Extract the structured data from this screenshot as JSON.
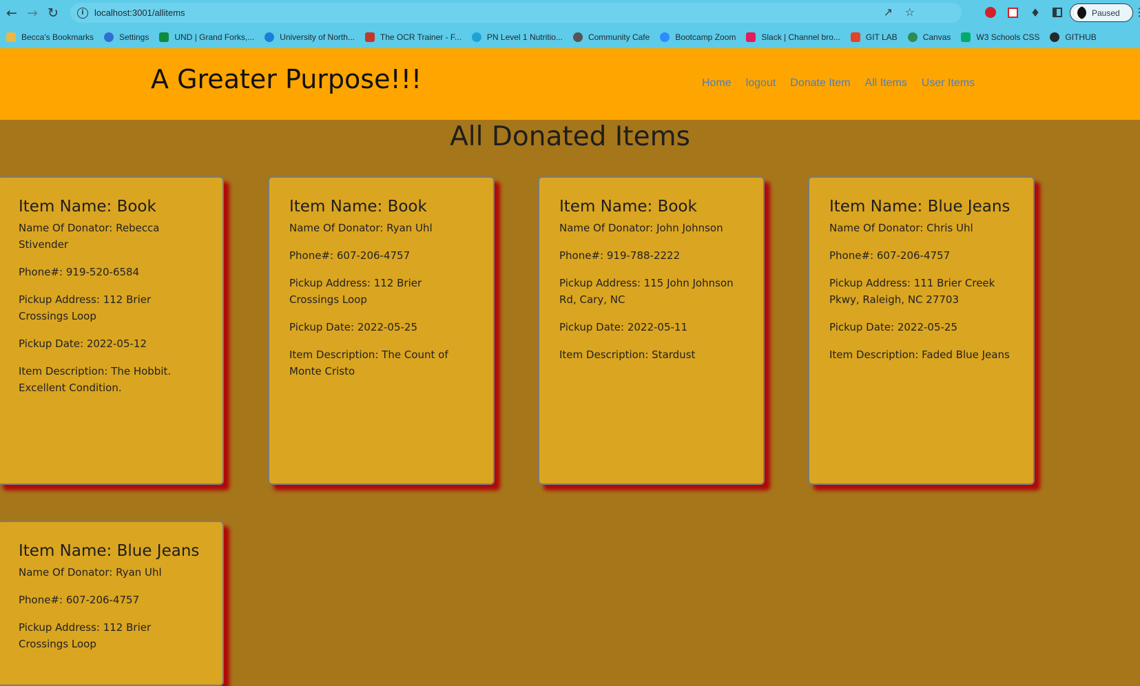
{
  "browser": {
    "url": "localhost:3001/allitems",
    "profile_status": "Paused",
    "bookmarks": [
      {
        "label": "Becca's Bookmarks",
        "icon": "folder-icon",
        "color": "#e8b84a"
      },
      {
        "label": "Settings",
        "icon": "gear-icon",
        "color": "#2f6fd1"
      },
      {
        "label": "UND | Grand Forks,...",
        "icon": "und-logo-icon",
        "color": "#0f8a3c"
      },
      {
        "label": "University of North...",
        "icon": "cloud-icon",
        "color": "#1a7fd6"
      },
      {
        "label": "The OCR Trainer - F...",
        "icon": "ocr-icon",
        "color": "#c0392b"
      },
      {
        "label": "PN Level 1 Nutritio...",
        "icon": "pn-icon",
        "color": "#1fa3d6"
      },
      {
        "label": "Community Cafe",
        "icon": "chrome-icon",
        "color": "#555555"
      },
      {
        "label": "Bootcamp Zoom",
        "icon": "zoom-icon",
        "color": "#2d8cff"
      },
      {
        "label": "Slack | Channel bro...",
        "icon": "slack-icon",
        "color": "#e01e5a"
      },
      {
        "label": "GIT LAB",
        "icon": "gitlab-icon",
        "color": "#e24329"
      },
      {
        "label": "Canvas",
        "icon": "canvas-icon",
        "color": "#2e8b57"
      },
      {
        "label": "W3 Schools CSS",
        "icon": "w3-icon",
        "color": "#04aa6d"
      },
      {
        "label": "GITHUB",
        "icon": "github-icon",
        "color": "#24292e"
      }
    ]
  },
  "header": {
    "brand": "A Greater Purpose!!!",
    "nav": [
      "Home",
      "logout",
      "Donate Item",
      "All Items",
      "User Items"
    ]
  },
  "main": {
    "title": "All Donated Items",
    "cards": [
      {
        "name": "Item Name: Book",
        "donator": "Name Of Donator: Rebecca Stivender",
        "phone": "Phone#: 919-520-6584",
        "address": "Pickup Address: 112 Brier Crossings Loop",
        "date": "Pickup Date: 2022-05-12",
        "description": "Item Description: The Hobbit. Excellent Condition."
      },
      {
        "name": "Item Name: Book",
        "donator": "Name Of Donator: Ryan Uhl",
        "phone": "Phone#: 607-206-4757",
        "address": "Pickup Address: 112 Brier Crossings Loop",
        "date": "Pickup Date: 2022-05-25",
        "description": "Item Description: The Count of Monte Cristo"
      },
      {
        "name": "Item Name: Book",
        "donator": "Name Of Donator: John Johnson",
        "phone": "Phone#: 919-788-2222",
        "address": "Pickup Address: 115 John Johnson Rd, Cary, NC",
        "date": "Pickup Date: 2022-05-11",
        "description": "Item Description: Stardust"
      },
      {
        "name": "Item Name: Blue Jeans",
        "donator": "Name Of Donator: Chris Uhl",
        "phone": "Phone#: 607-206-4757",
        "address": "Pickup Address: 111 Brier Creek Pkwy, Raleigh, NC 27703",
        "date": "Pickup Date: 2022-05-25",
        "description": "Item Description: Faded Blue Jeans"
      },
      {
        "name": "Item Name: Blue Jeans",
        "donator": "Name Of Donator: Ryan Uhl",
        "phone": "Phone#: 607-206-4757",
        "address": "Pickup Address: 112 Brier Crossings Loop"
      }
    ]
  },
  "colors": {
    "header_bg": "#ffa500",
    "page_bg": "#a6761a",
    "card_bg": "#daa520",
    "card_shadow": "#b00808",
    "nav_link": "#4a7fc1"
  }
}
